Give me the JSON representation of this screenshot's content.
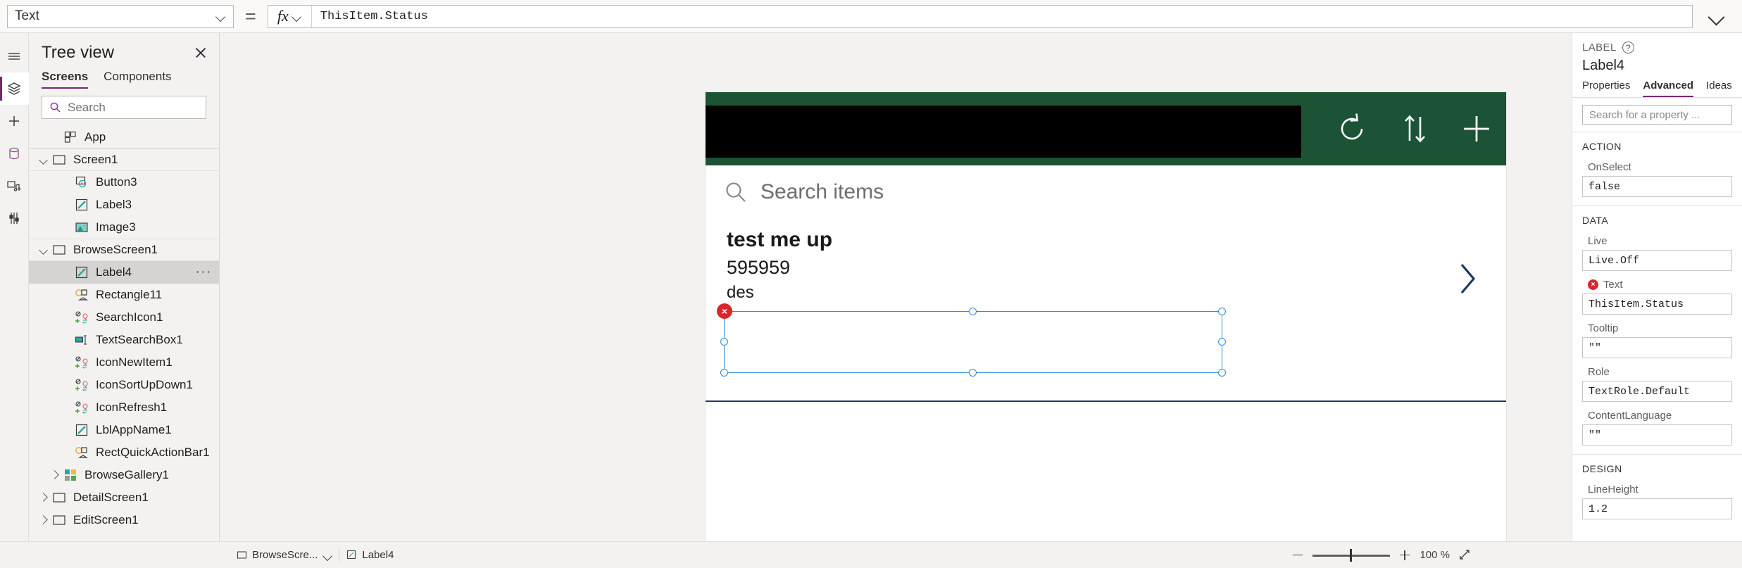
{
  "formula_bar": {
    "property_selected": "Text",
    "equals": "=",
    "fx_label": "fx",
    "formula": "ThisItem.Status"
  },
  "rail": {
    "items": [
      {
        "name": "hamburger-menu-icon",
        "label": "Menu"
      },
      {
        "name": "tree-view-icon",
        "label": "Tree view"
      },
      {
        "name": "insert-icon",
        "label": "Insert"
      },
      {
        "name": "data-icon",
        "label": "Data"
      },
      {
        "name": "media-icon",
        "label": "Media"
      },
      {
        "name": "settings-icon",
        "label": "Advanced tools"
      }
    ]
  },
  "tree_panel": {
    "title": "Tree view",
    "close_label": "Close",
    "tabs": [
      {
        "label": "Screens",
        "active": true
      },
      {
        "label": "Components",
        "active": false
      }
    ],
    "search_placeholder": "Search",
    "items": [
      {
        "label": "App",
        "icon": "app-icon",
        "indent": 1,
        "twist": "none",
        "selected": false,
        "divider": "app"
      },
      {
        "label": "Screen1",
        "icon": "screen-icon",
        "indent": 0,
        "twist": "open",
        "selected": false,
        "divider": "screen"
      },
      {
        "label": "Button3",
        "icon": "button-icon",
        "indent": 2,
        "twist": "none",
        "selected": false
      },
      {
        "label": "Label3",
        "icon": "label-icon",
        "indent": 2,
        "twist": "none",
        "selected": false
      },
      {
        "label": "Image3",
        "icon": "image-icon",
        "indent": 2,
        "twist": "none",
        "selected": false
      },
      {
        "label": "BrowseScreen1",
        "icon": "screen-icon",
        "indent": 0,
        "twist": "open",
        "selected": false,
        "divider": "screen"
      },
      {
        "label": "Label4",
        "icon": "label-icon",
        "indent": 2,
        "twist": "none",
        "selected": true,
        "more": "···"
      },
      {
        "label": "Rectangle11",
        "icon": "shape-icon",
        "indent": 2,
        "twist": "none",
        "selected": false
      },
      {
        "label": "SearchIcon1",
        "icon": "icon-icon",
        "indent": 2,
        "twist": "none",
        "selected": false
      },
      {
        "label": "TextSearchBox1",
        "icon": "textinput-icon",
        "indent": 2,
        "twist": "none",
        "selected": false
      },
      {
        "label": "IconNewItem1",
        "icon": "icon-icon",
        "indent": 2,
        "twist": "none",
        "selected": false
      },
      {
        "label": "IconSortUpDown1",
        "icon": "icon-icon",
        "indent": 2,
        "twist": "none",
        "selected": false
      },
      {
        "label": "IconRefresh1",
        "icon": "icon-icon",
        "indent": 2,
        "twist": "none",
        "selected": false
      },
      {
        "label": "LblAppName1",
        "icon": "label-icon",
        "indent": 2,
        "twist": "none",
        "selected": false
      },
      {
        "label": "RectQuickActionBar1",
        "icon": "shape-icon",
        "indent": 2,
        "twist": "none",
        "selected": false
      },
      {
        "label": "BrowseGallery1",
        "icon": "gallery-icon",
        "indent": 1,
        "twist": "closed",
        "selected": false
      },
      {
        "label": "DetailScreen1",
        "icon": "screen-icon",
        "indent": 0,
        "twist": "closed",
        "selected": false
      },
      {
        "label": "EditScreen1",
        "icon": "screen-icon",
        "indent": 0,
        "twist": "closed",
        "selected": false
      }
    ]
  },
  "canvas": {
    "header_color": "#1b5334",
    "header_icons": [
      {
        "name": "refresh-icon"
      },
      {
        "name": "sort-updown-icon"
      },
      {
        "name": "add-new-item-icon"
      }
    ],
    "search_placeholder": "Search items",
    "gallery_item": {
      "title": "test me up",
      "subtitle": "595959",
      "third_line": "des",
      "chevron": "next-item-chevron-icon"
    },
    "error_badge": "×",
    "selection": "Label4"
  },
  "properties_panel": {
    "kicker": "LABEL",
    "help_glyph": "?",
    "control_name": "Label4",
    "tabs": [
      {
        "label": "Properties",
        "active": false
      },
      {
        "label": "Advanced",
        "active": true
      },
      {
        "label": "Ideas",
        "active": false
      }
    ],
    "search_placeholder": "Search for a property ...",
    "sections": [
      {
        "title": "ACTION",
        "fields": [
          {
            "label": "OnSelect",
            "value": "false",
            "error": false
          }
        ]
      },
      {
        "title": "DATA",
        "fields": [
          {
            "label": "Live",
            "value": "Live.Off",
            "error": false
          },
          {
            "label": "Text",
            "value": "ThisItem.Status",
            "error": true
          },
          {
            "label": "Tooltip",
            "value": "\"\"",
            "error": false
          },
          {
            "label": "Role",
            "value": "TextRole.Default",
            "error": false
          },
          {
            "label": "ContentLanguage",
            "value": "\"\"",
            "error": false
          }
        ]
      },
      {
        "title": "DESIGN",
        "fields": [
          {
            "label": "LineHeight",
            "value": "1.2",
            "error": false
          }
        ]
      }
    ]
  },
  "status_bar": {
    "screen_chip": "BrowseScre...",
    "control_chip": "Label4",
    "zoom_value": "100 %",
    "zoom_out": "-",
    "zoom_in": "+",
    "fit_label": "Fit to screen"
  }
}
